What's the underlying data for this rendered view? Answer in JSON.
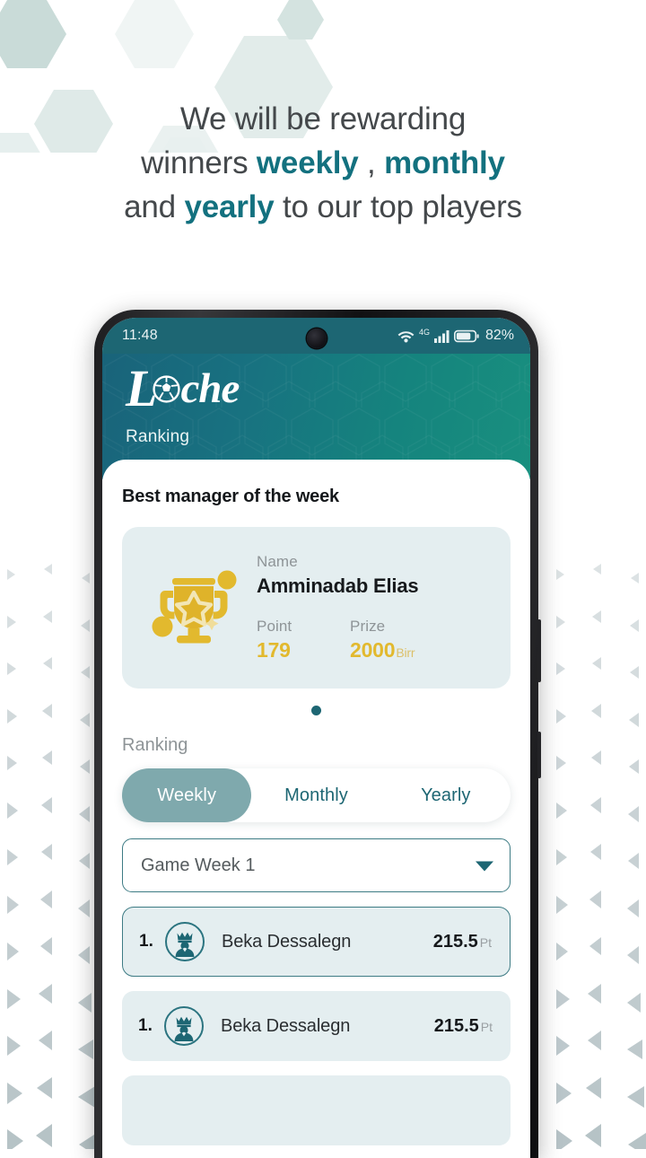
{
  "promo": {
    "line1_prefix": "We will be rewarding",
    "line2_prefix": "winners ",
    "line2_b1": "weekly",
    "line2_mid": " , ",
    "line2_b2": "monthly",
    "line3_prefix": "and ",
    "line3_b1": "yearly",
    "line3_suffix": " to our top players",
    "accent_color": "#13717f",
    "text_color": "#44484b"
  },
  "status_bar": {
    "clock": "11:48",
    "network_label": "4G",
    "battery_percent": "82%",
    "wifi_icon": "wifi-icon",
    "signal_icon": "signal-bars-icon",
    "battery_icon": "battery-icon",
    "background": "#1d6673"
  },
  "app_header": {
    "logo_l": "L",
    "logo_rest": "che",
    "logo_ball_icon": "soccer-ball-icon",
    "subtitle": "Ranking",
    "gradient_from": "#19637a",
    "gradient_to": "#19907f"
  },
  "best_manager": {
    "section_label": "Best manager of the week",
    "trophy_icon": "trophy-icon",
    "name_label": "Name",
    "name_value": "Amminadab Elias",
    "point_label": "Point",
    "point_value": "179",
    "prize_label": "Prize",
    "prize_value": "2000",
    "prize_unit": "Birr",
    "gold_color": "#e2b92e",
    "card_bg": "#e4eef0"
  },
  "carousel": {
    "dot_count": 1,
    "active_index": 0,
    "dot_color": "#1d6673"
  },
  "ranking": {
    "label": "Ranking",
    "tabs": [
      {
        "label": "Weekly",
        "active": true
      },
      {
        "label": "Monthly",
        "active": false
      },
      {
        "label": "Yearly",
        "active": false
      }
    ],
    "active_tab_bg": "#7fa9ad",
    "week_select": {
      "value": "Game Week 1",
      "caret_icon": "chevron-down-icon"
    },
    "points_unit": "Pt",
    "rows": [
      {
        "position": "1.",
        "name": "Beka Dessalegn",
        "points": "215.5",
        "avatar_icon": "crowned-user-icon",
        "highlighted": true
      },
      {
        "position": "1.",
        "name": "Beka Dessalegn",
        "points": "215.5",
        "avatar_icon": "crowned-user-icon",
        "highlighted": false
      },
      {
        "position": "",
        "name": "",
        "points": "",
        "avatar_icon": "crowned-user-icon",
        "highlighted": false
      }
    ]
  }
}
